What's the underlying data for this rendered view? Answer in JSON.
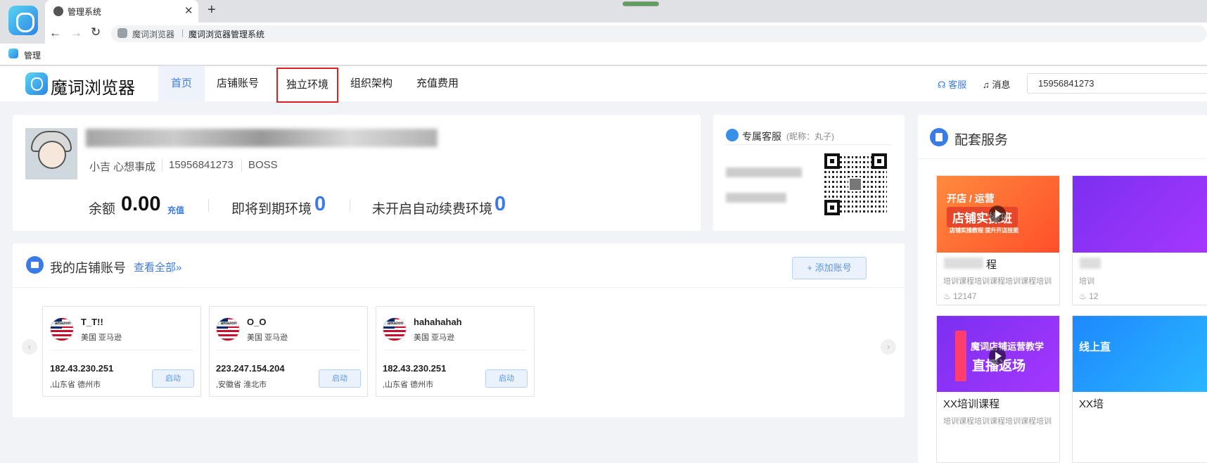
{
  "browser": {
    "tab_title": "管理系统",
    "tab_close": "✕",
    "new_tab": "+",
    "back": "←",
    "forward": "→",
    "reload": "↻",
    "address_site": "魔词浏览器",
    "address_sep": "|",
    "address_title": "魔词浏览器管理系统",
    "bookmark_label": "管理"
  },
  "header": {
    "brand_name": "魔词浏览器",
    "nav": [
      "首页",
      "店铺账号",
      "独立环境",
      "组织架构",
      "充值费用"
    ],
    "active_nav_index": 0,
    "highlighted_nav_index": 2,
    "customer_service": "客服",
    "messages": "消息",
    "user_phone": "15956841273"
  },
  "profile": {
    "name": "小吉 心想事成",
    "phone": "15956841273",
    "role": "BOSS",
    "balance_label": "余额",
    "balance_value": "0.00",
    "recharge": "充值",
    "expiring_label": "即将到期环境",
    "expiring_value": "0",
    "auto_renew_label": "未开启自动续费环境",
    "auto_renew_value": "0"
  },
  "service": {
    "title": "专属客服",
    "nickname": "(昵称：丸子)"
  },
  "shops": {
    "title": "我的店铺账号",
    "view_all": "查看全部»",
    "add_button": "+ 添加账号",
    "prev": "‹",
    "next": "›",
    "items": [
      {
        "name": "T_T!!",
        "region": "美国 亚马逊",
        "ip": "182.43.230.251",
        "location": ",山东省 德州市",
        "button": "启动",
        "brand": "amazon"
      },
      {
        "name": "O_O",
        "region": "美国 亚马逊",
        "ip": "223.247.154.204",
        "location": ",安徽省 淮北市",
        "button": "启动",
        "brand": "amazon"
      },
      {
        "name": "hahahahah",
        "region": "美国 亚马逊",
        "ip": "182.43.230.251",
        "location": ",山东省 德州市",
        "button": "启动",
        "brand": "amazon"
      }
    ]
  },
  "services_panel": {
    "title": "配套服务",
    "courses": [
      {
        "thumb_line1": "开店 / 运营",
        "thumb_tag": "店铺实操班",
        "thumb_line2": "店铺实操教程 提升开店技能",
        "title": "程",
        "desc": "培训课程培训课程培训课程培训",
        "views": "12147"
      },
      {
        "thumb_line1": "魔词店铺运营教学",
        "thumb_tag": "直播返场",
        "thumb_line2": "",
        "title": "XX培训课程",
        "desc": "培训课程培训课程培训课程培训",
        "views": ""
      }
    ],
    "side_views": "12",
    "side_desc": "培训",
    "side_title": "XX培",
    "side_thumb": "线上直"
  },
  "colors": {
    "accent": "#3a7be8",
    "highlight_border": "#e02020"
  }
}
